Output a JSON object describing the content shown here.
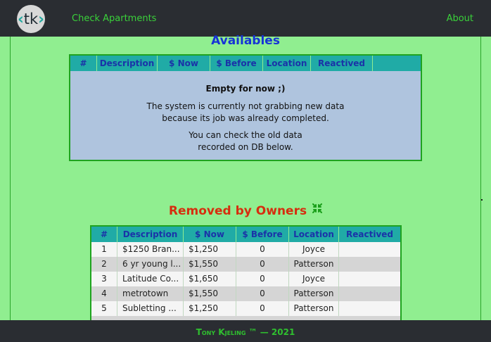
{
  "nav": {
    "logo_text": "tk",
    "link_left": "Check Apartments",
    "link_right": "About"
  },
  "availables": {
    "title": "Availables",
    "columns": [
      "#",
      "Description",
      "$ Now",
      "$ Before",
      "Location",
      "Reactived",
      ""
    ],
    "empty_title": "Empty for now ;)",
    "empty_line1": "The system is currently not grabbing new data",
    "empty_line2": "because its job was already completed.",
    "empty_line3": "You can check the old data",
    "empty_line4": "recorded on DB below."
  },
  "removed": {
    "title": "Removed by Owners",
    "columns": [
      "#",
      "Description",
      "$ Now",
      "$ Before",
      "Location",
      "Reactived"
    ],
    "rows": [
      {
        "num": "1",
        "desc": "$1250 Bran...",
        "now": "$1,250",
        "before": "0",
        "location": "Joyce",
        "reactived": ""
      },
      {
        "num": "2",
        "desc": "6 yr young l...",
        "now": "$1,550",
        "before": "0",
        "location": "Patterson",
        "reactived": ""
      },
      {
        "num": "3",
        "desc": "Latitude Co...",
        "now": "$1,650",
        "before": "0",
        "location": "Joyce",
        "reactived": ""
      },
      {
        "num": "4",
        "desc": "metrotown",
        "now": "$1,550",
        "before": "0",
        "location": "Patterson",
        "reactived": ""
      },
      {
        "num": "5",
        "desc": "Subletting ...",
        "now": "$1,250",
        "before": "0",
        "location": "Patterson",
        "reactived": ""
      }
    ]
  },
  "footer": {
    "text": "Tony Kjeling ™  —  2021"
  },
  "colors": {
    "background": "#90ee90",
    "navbar": "#2a2d32",
    "accent_green": "#3ad13a",
    "header_teal": "#20aba6",
    "availables_title": "#1633d6",
    "removed_title": "#d62e0f"
  }
}
